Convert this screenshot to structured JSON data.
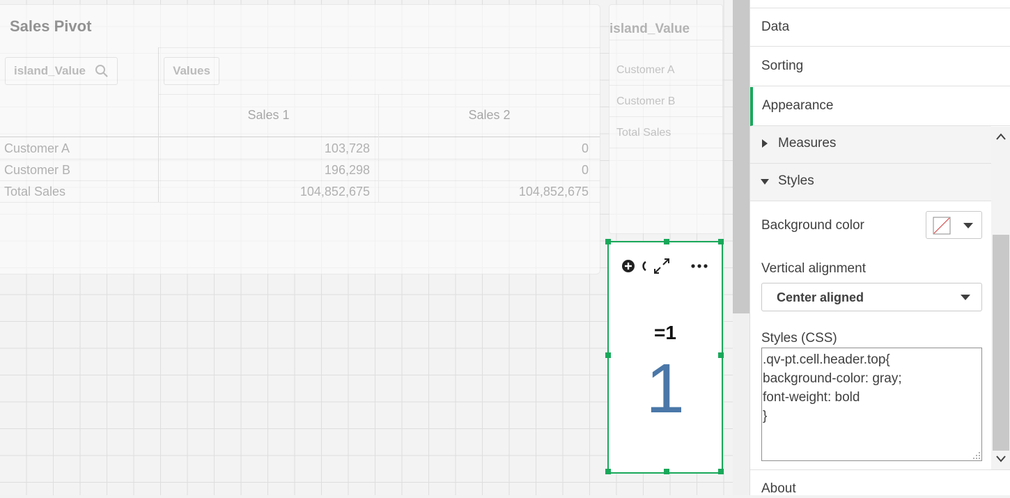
{
  "pivot": {
    "title": "Sales Pivot",
    "dimension_chip": "island_Value",
    "values_chip": "Values",
    "columns": [
      "Sales 1",
      "Sales 2"
    ],
    "rows": [
      {
        "label": "Customer A",
        "sales1": "103,728",
        "sales2": "0"
      },
      {
        "label": "Customer B",
        "sales1": "196,298",
        "sales2": "0"
      },
      {
        "label": "Total Sales",
        "sales1": "104,852,675",
        "sales2": "104,852,675"
      }
    ]
  },
  "filter": {
    "title": "island_Value",
    "items": [
      "Customer A",
      "Customer B",
      "Total Sales"
    ]
  },
  "text_object": {
    "formula": "=1",
    "value": "1"
  },
  "panel": {
    "sections": {
      "data": "Data",
      "sorting": "Sorting",
      "appearance": "Appearance",
      "about": "About"
    },
    "measures": "Measures",
    "styles": "Styles",
    "background_color_label": "Background color",
    "vertical_alignment_label": "Vertical alignment",
    "vertical_alignment_value": "Center aligned",
    "styles_css_label": "Styles (CSS)",
    "styles_css_value": ".qv-pt.cell.header.top{\nbackground-color: gray;\nfont-weight: bold\n}"
  },
  "colors": {
    "accent": "#19a85a",
    "value_blue": "#4a77a8"
  }
}
